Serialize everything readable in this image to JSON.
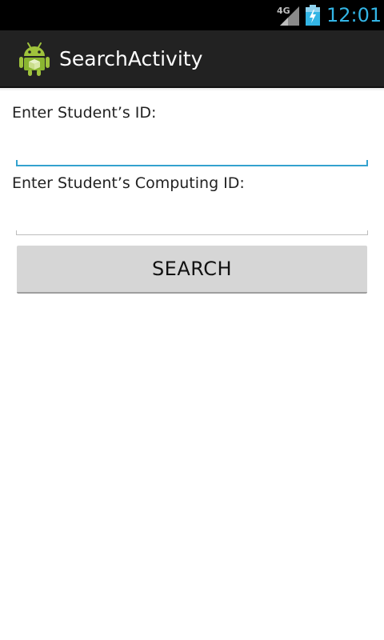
{
  "status_bar": {
    "network_type": "4G",
    "time": "12:01",
    "signal_icon": "signal-icon",
    "battery_icon": "battery-charging-icon"
  },
  "action_bar": {
    "icon": "android-app-icon",
    "title": "SearchActivity"
  },
  "form": {
    "student_id_label": "Enter Student’s ID:",
    "student_id_value": "",
    "computing_id_label": "Enter Student’s Computing ID:",
    "computing_id_value": "",
    "search_button_label": "SEARCH"
  },
  "colors": {
    "accent": "#33b5e5",
    "focused_underline": "#33a2cf",
    "action_bar_bg": "#222222",
    "button_bg": "#d6d6d6"
  }
}
